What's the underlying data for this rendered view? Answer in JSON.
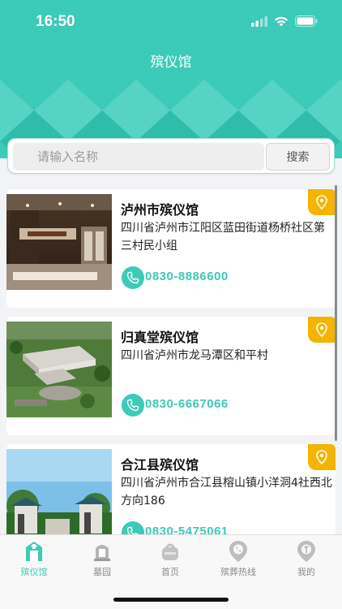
{
  "status_bar": {
    "time": "16:50"
  },
  "header": {
    "title": "殡仪馆"
  },
  "search": {
    "placeholder": "请输入名称",
    "button_label": "搜索"
  },
  "colors": {
    "primary": "#3ccab9",
    "badge": "#f4b400"
  },
  "funeral_homes": [
    {
      "name": "泸州市殡仪馆",
      "address": "四川省泸州市江阳区蓝田街道杨桥社区第三村民小组",
      "phone": "0830-8886600"
    },
    {
      "name": "归真堂殡仪馆",
      "address": "四川省泸州市龙马潭区和平村",
      "phone": "0830-6667066"
    },
    {
      "name": "合江县殡仪馆",
      "address": "四川省泸州市合江县榕山镇小洋洞4社西北方向186",
      "phone": "0830-5475061"
    }
  ],
  "tabs": [
    {
      "label": "殡仪馆",
      "icon": "funeral-home-icon",
      "active": true
    },
    {
      "label": "墓园",
      "icon": "cemetery-icon",
      "active": false
    },
    {
      "label": "首页",
      "icon": "home-icon",
      "active": false
    },
    {
      "label": "殡葬热线",
      "icon": "hotline-icon",
      "active": false
    },
    {
      "label": "我的",
      "icon": "profile-icon",
      "active": false
    }
  ]
}
